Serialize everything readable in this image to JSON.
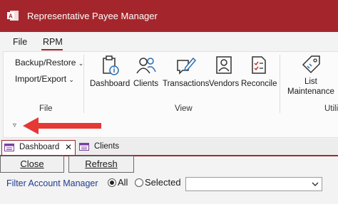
{
  "app": {
    "title": "Representative Payee Manager"
  },
  "menu": [
    {
      "label": "File"
    },
    {
      "label": "RPM"
    }
  ],
  "ribbon": {
    "file_group": {
      "label": "File",
      "items": [
        {
          "label": "Backup/Restore"
        },
        {
          "label": "Import/Export"
        }
      ]
    },
    "view_group": {
      "label": "View",
      "buttons": [
        {
          "label": "Dashboard",
          "icon": "clipboard-info-icon"
        },
        {
          "label": "Clients",
          "icon": "people-icon"
        },
        {
          "label": "Transactions",
          "icon": "edit-comment-icon"
        },
        {
          "label": "Vendors",
          "icon": "contact-card-icon"
        },
        {
          "label": "Reconcile",
          "icon": "checklist-icon"
        }
      ]
    },
    "util_group": {
      "label": "Utili",
      "buttons": [
        {
          "label": "List Maintenance",
          "line1": "List",
          "line2": "Maintenance",
          "icon": "tag-icon"
        }
      ]
    }
  },
  "tabs": [
    {
      "label": "Dashboard",
      "active": true
    },
    {
      "label": "Clients",
      "active": false
    }
  ],
  "actions": {
    "close_label": "Close",
    "refresh_label": "Refresh"
  },
  "filter": {
    "label": "Filter Account Manager",
    "options": [
      {
        "label": "All",
        "selected": true
      },
      {
        "label": "Selected",
        "selected": false
      }
    ],
    "selected_value": ""
  },
  "colors": {
    "accent": "#a4262c",
    "label_blue": "#1f3b8f"
  }
}
